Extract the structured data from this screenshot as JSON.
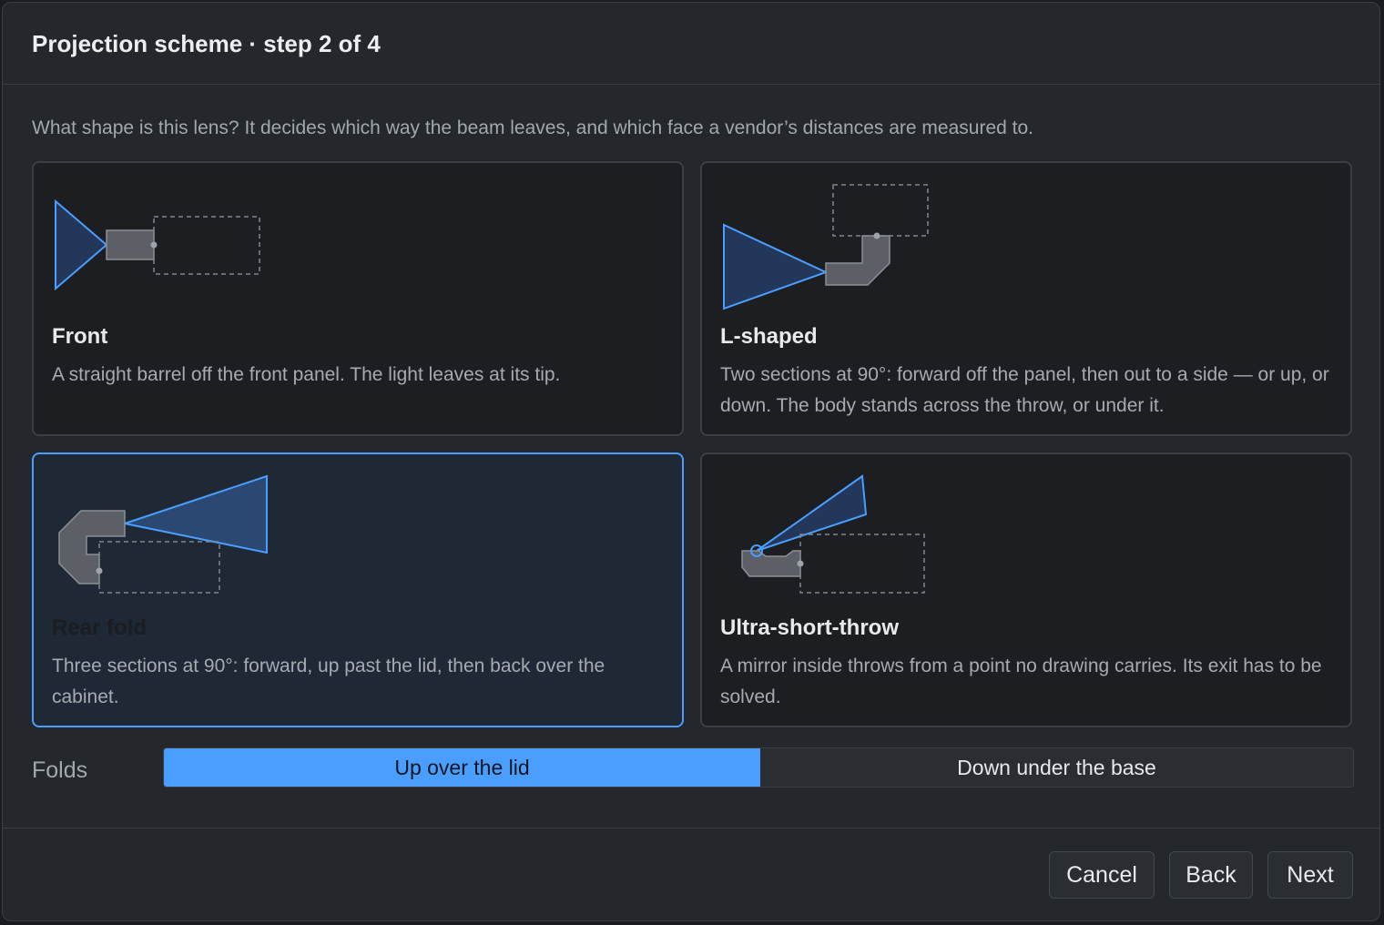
{
  "dialog": {
    "title": "Projection scheme · step 2 of 4",
    "prompt": "What shape is this lens? It decides which way the beam leaves, and which face a vendor’s distances are measured to."
  },
  "options": [
    {
      "title": "Front",
      "description": "A straight barrel off the front panel. The light leaves at its tip.",
      "selected": false
    },
    {
      "title": "L-shaped",
      "description": "Two sections at 90°: forward off the panel, then out to a side — or up, or down. The body stands across the throw, or under it.",
      "selected": false
    },
    {
      "title": "Rear fold",
      "description": "Three sections at 90°: forward, up past the lid, then back over the cabinet.",
      "selected": true
    },
    {
      "title": "Ultra-short-throw",
      "description": "A mirror inside throws from a point no drawing carries. Its exit has to be solved.",
      "selected": false
    }
  ],
  "folds": {
    "label": "Folds",
    "options": [
      "Up over the lid",
      "Down under the base"
    ],
    "selected": "Up over the lid"
  },
  "footer": {
    "cancel": "Cancel",
    "back": "Back",
    "next": "Next"
  },
  "colors": {
    "accent": "#4a9eff",
    "beam_fill": "#22375a",
    "body_fill": "#5c6066"
  }
}
